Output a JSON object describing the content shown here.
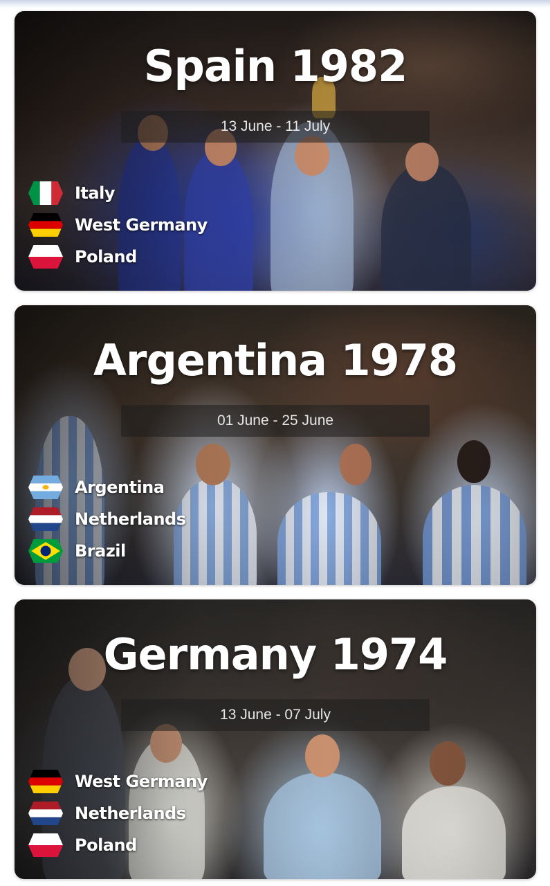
{
  "tournaments": [
    {
      "title": "Spain 1982",
      "dates": "13 June - 11 July",
      "teams": [
        {
          "name": "Italy",
          "flag": "italy-flag-icon"
        },
        {
          "name": "West Germany",
          "flag": "germany-flag-icon"
        },
        {
          "name": "Poland",
          "flag": "poland-flag-icon"
        }
      ]
    },
    {
      "title": "Argentina 1978",
      "dates": "01 June - 25 June",
      "teams": [
        {
          "name": "Argentina",
          "flag": "argentina-flag-icon"
        },
        {
          "name": "Netherlands",
          "flag": "netherlands-flag-icon"
        },
        {
          "name": "Brazil",
          "flag": "brazil-flag-icon"
        }
      ]
    },
    {
      "title": "Germany 1974",
      "dates": "13 June - 07 July",
      "teams": [
        {
          "name": "West Germany",
          "flag": "germany-flag-icon"
        },
        {
          "name": "Netherlands",
          "flag": "netherlands-flag-icon"
        },
        {
          "name": "Poland",
          "flag": "poland-flag-icon"
        }
      ]
    }
  ],
  "colors": {
    "title_text": "#ffffff",
    "date_band": "#1e1e1e",
    "italy": [
      "#009246",
      "#ffffff",
      "#ce2b37"
    ],
    "germany": [
      "#000000",
      "#dd0000",
      "#ffce00"
    ],
    "poland": [
      "#ffffff",
      "#dc143c"
    ],
    "netherlands": [
      "#ae1c28",
      "#ffffff",
      "#21468b"
    ],
    "argentina": [
      "#74acdf",
      "#ffffff",
      "#f6b40e"
    ],
    "brazil": [
      "#009c3b",
      "#ffdf00",
      "#002776"
    ]
  }
}
